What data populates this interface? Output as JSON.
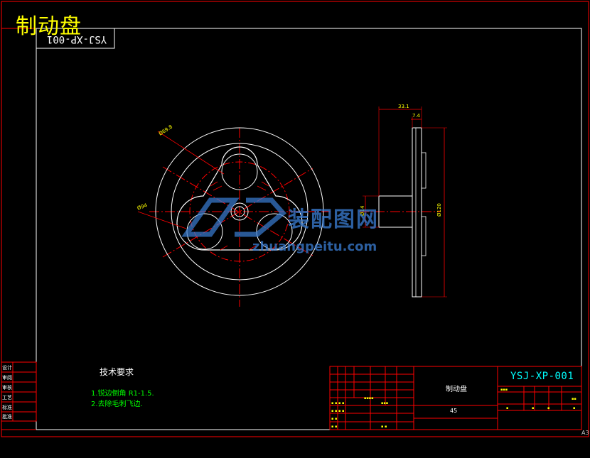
{
  "title": "制动盘",
  "mirrored_code": "YSJ-XP-001",
  "drawing_number": "YSJ-XP-001",
  "part_name": "制动盘",
  "material": "45",
  "sheet_size": "A3",
  "technical_requirements": {
    "heading": "技术要求",
    "notes": [
      "1.锐边倒角 R1-1.5.",
      "2.去除毛刺飞边."
    ]
  },
  "side_table": [
    "设计",
    "审阅",
    "审核",
    "工艺",
    "标准",
    "批准"
  ],
  "dimensions": {
    "top_view": [
      "Ø69.8",
      "Ø94"
    ],
    "side_view": [
      "33.1",
      "7.4",
      "Ø120",
      "Ø14"
    ]
  },
  "watermark": {
    "text": "装配图网",
    "url": "zhuangpeitu.com"
  },
  "colors": {
    "background": "#000000",
    "frame": "#ff0000",
    "outline": "#ffffff",
    "center_lines": "#ff0000",
    "dimension_text": "#ffff00",
    "title_text": "#ffff00",
    "notes": "#00ff00",
    "drawing_code": "#00ffff",
    "watermark": "#3b7fd6"
  }
}
